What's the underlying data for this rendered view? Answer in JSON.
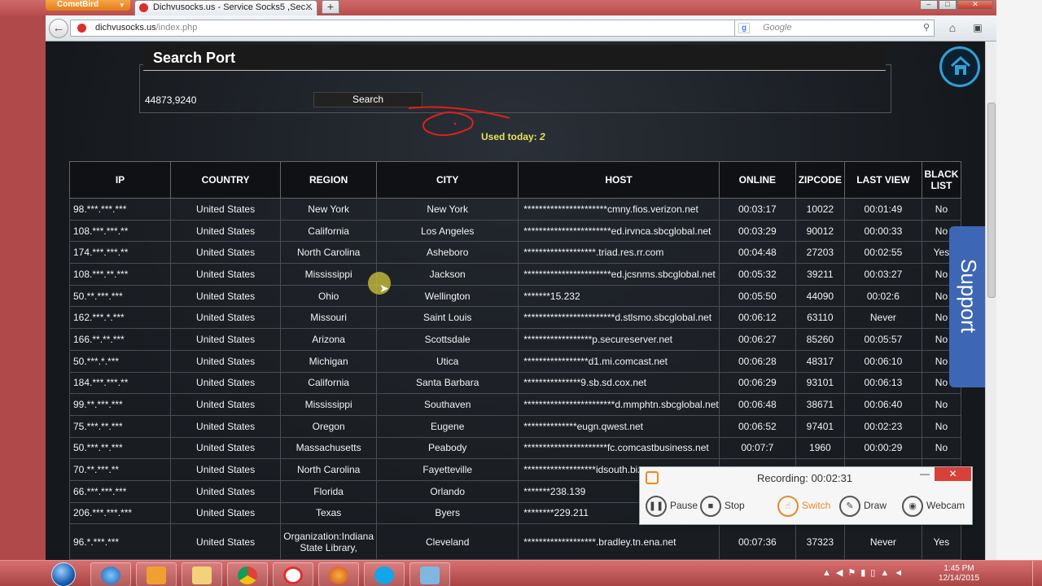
{
  "browser": {
    "app_button": "CometBird",
    "tab_title": "Dichvusocks.us - Service Socks5 ,Sec...",
    "url_domain": "dichvusocks.us",
    "url_path": "/index.php",
    "search_placeholder": "Google"
  },
  "search": {
    "title": "Search Port",
    "port_value": "44873,9240",
    "button_label": "Search",
    "used_today_label": "Used today:",
    "used_today_count": "2"
  },
  "table": {
    "headers": [
      "IP",
      "COUNTRY",
      "REGION",
      "CITY",
      "HOST",
      "ONLINE",
      "ZIPCODE",
      "LAST VIEW",
      "BLACK LIST"
    ],
    "rows": [
      [
        "98.***.***.***",
        "United States",
        "New York",
        "New York",
        "**********************cmny.fios.verizon.net",
        "00:03:17",
        "10022",
        "00:01:49",
        "No"
      ],
      [
        "108.***.***.**",
        "United States",
        "California",
        "Los Angeles",
        "***********************ed.irvnca.sbcglobal.net",
        "00:03:29",
        "90012",
        "00:00:33",
        "No"
      ],
      [
        "174.***.***.**",
        "United States",
        "North Carolina",
        "Asheboro",
        "*******************.triad.res.rr.com",
        "00:04:48",
        "27203",
        "00:02:55",
        "Yes"
      ],
      [
        "108.***.**.***",
        "United States",
        "Mississippi",
        "Jackson",
        "***********************ed.jcsnms.sbcglobal.net",
        "00:05:32",
        "39211",
        "00:03:27",
        "No"
      ],
      [
        "50.**.***.***",
        "United States",
        "Ohio",
        "Wellington",
        "*******15.232",
        "00:05:50",
        "44090",
        "00:02:6",
        "No"
      ],
      [
        "162.***.*.***",
        "United States",
        "Missouri",
        "Saint Louis",
        "************************d.stlsmo.sbcglobal.net",
        "00:06:12",
        "63110",
        "Never",
        "No"
      ],
      [
        "166.**.**.***",
        "United States",
        "Arizona",
        "Scottsdale",
        "******************p.secureserver.net",
        "00:06:27",
        "85260",
        "00:05:57",
        "No"
      ],
      [
        "50.***.*.***",
        "United States",
        "Michigan",
        "Utica",
        "*****************d1.mi.comcast.net",
        "00:06:28",
        "48317",
        "00:06:10",
        "No"
      ],
      [
        "184.***.***.**",
        "United States",
        "California",
        "Santa Barbara",
        "***************9.sb.sd.cox.net",
        "00:06:29",
        "93101",
        "00:06:13",
        "No"
      ],
      [
        "99.**.***.***",
        "United States",
        "Mississippi",
        "Southaven",
        "************************d.mmphtn.sbcglobal.net",
        "00:06:48",
        "38671",
        "00:06:40",
        "No"
      ],
      [
        "75.***.**.***",
        "United States",
        "Oregon",
        "Eugene",
        "**************eugn.qwest.net",
        "00:06:52",
        "97401",
        "00:02:23",
        "No"
      ],
      [
        "50.***.**.***",
        "United States",
        "Massachusetts",
        "Peabody",
        "**********************fc.comcastbusiness.net",
        "00:07:7",
        "1960",
        "00:00:29",
        "No"
      ],
      [
        "70.**.***.**",
        "United States",
        "North Carolina",
        "Fayetteville",
        "*******************idsouth.biz",
        "",
        "",
        "",
        ""
      ],
      [
        "66.***.***.***",
        "United States",
        "Florida",
        "Orlando",
        "*******238.139",
        "",
        "",
        "",
        ""
      ],
      [
        "206.***.***.***",
        "United States",
        "Texas",
        "Byers",
        "********229.211",
        "",
        "",
        "",
        ""
      ],
      [
        "96.*.***.***",
        "United States",
        "Organization:Indiana State Library,",
        "Cleveland",
        "*******************.bradley.tn.ena.net",
        "00:07:36",
        "37323",
        "Never",
        "Yes"
      ]
    ]
  },
  "support_label": "Support",
  "recorder": {
    "status": "Recording:  00:02:31",
    "pause": "Pause",
    "stop": "Stop",
    "switch": "Switch",
    "draw": "Draw",
    "webcam": "Webcam"
  },
  "clock": {
    "time": "1:45 PM",
    "date": "12/14/2015"
  }
}
